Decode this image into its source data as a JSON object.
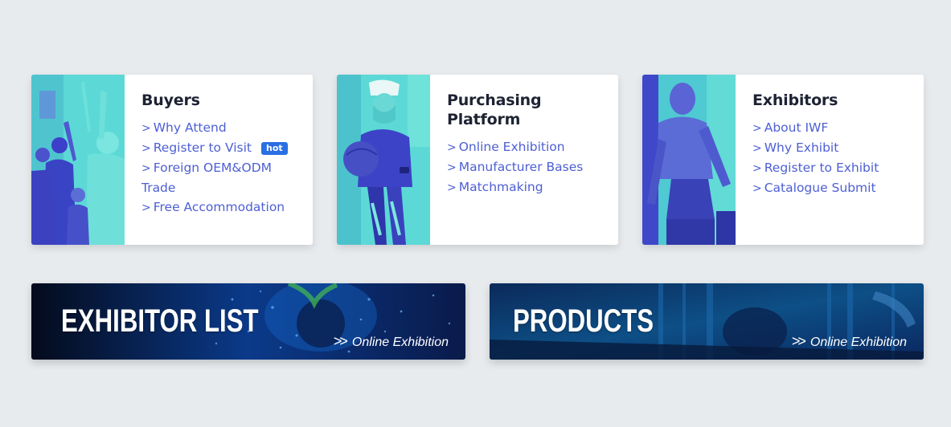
{
  "cards": [
    {
      "title": "Buyers",
      "links": [
        "Why Attend",
        "Register to Visit",
        "Foreign OEM&ODM Trade",
        "Free Accommodation"
      ],
      "badge": "hot",
      "image": "fitness-class-photo"
    },
    {
      "title": "Purchasing Platform",
      "links": [
        "Online Exhibition",
        "Manufacturer Bases",
        "Matchmaking"
      ],
      "image": "woman-with-medicine-ball-photo"
    },
    {
      "title": "Exhibitors",
      "links": [
        "About IWF",
        "Why Exhibit",
        "Register to Exhibit",
        "Catalogue Submit"
      ],
      "image": "man-exercising-photo"
    }
  ],
  "banners": [
    {
      "title": "EXHIBITOR LIST",
      "subtitle": "Online Exhibition",
      "icon": "double-chevron-right"
    },
    {
      "title": "PRODUCTS",
      "subtitle": "Online Exhibition",
      "icon": "double-chevron-right"
    }
  ],
  "colors": {
    "background": "#e8ebee",
    "link": "#4d5fd3",
    "title": "#1e2333",
    "hot_badge": "#2a6fe3",
    "duotone_light": "#5fe3dc",
    "duotone_dark": "#3b3fc9"
  }
}
